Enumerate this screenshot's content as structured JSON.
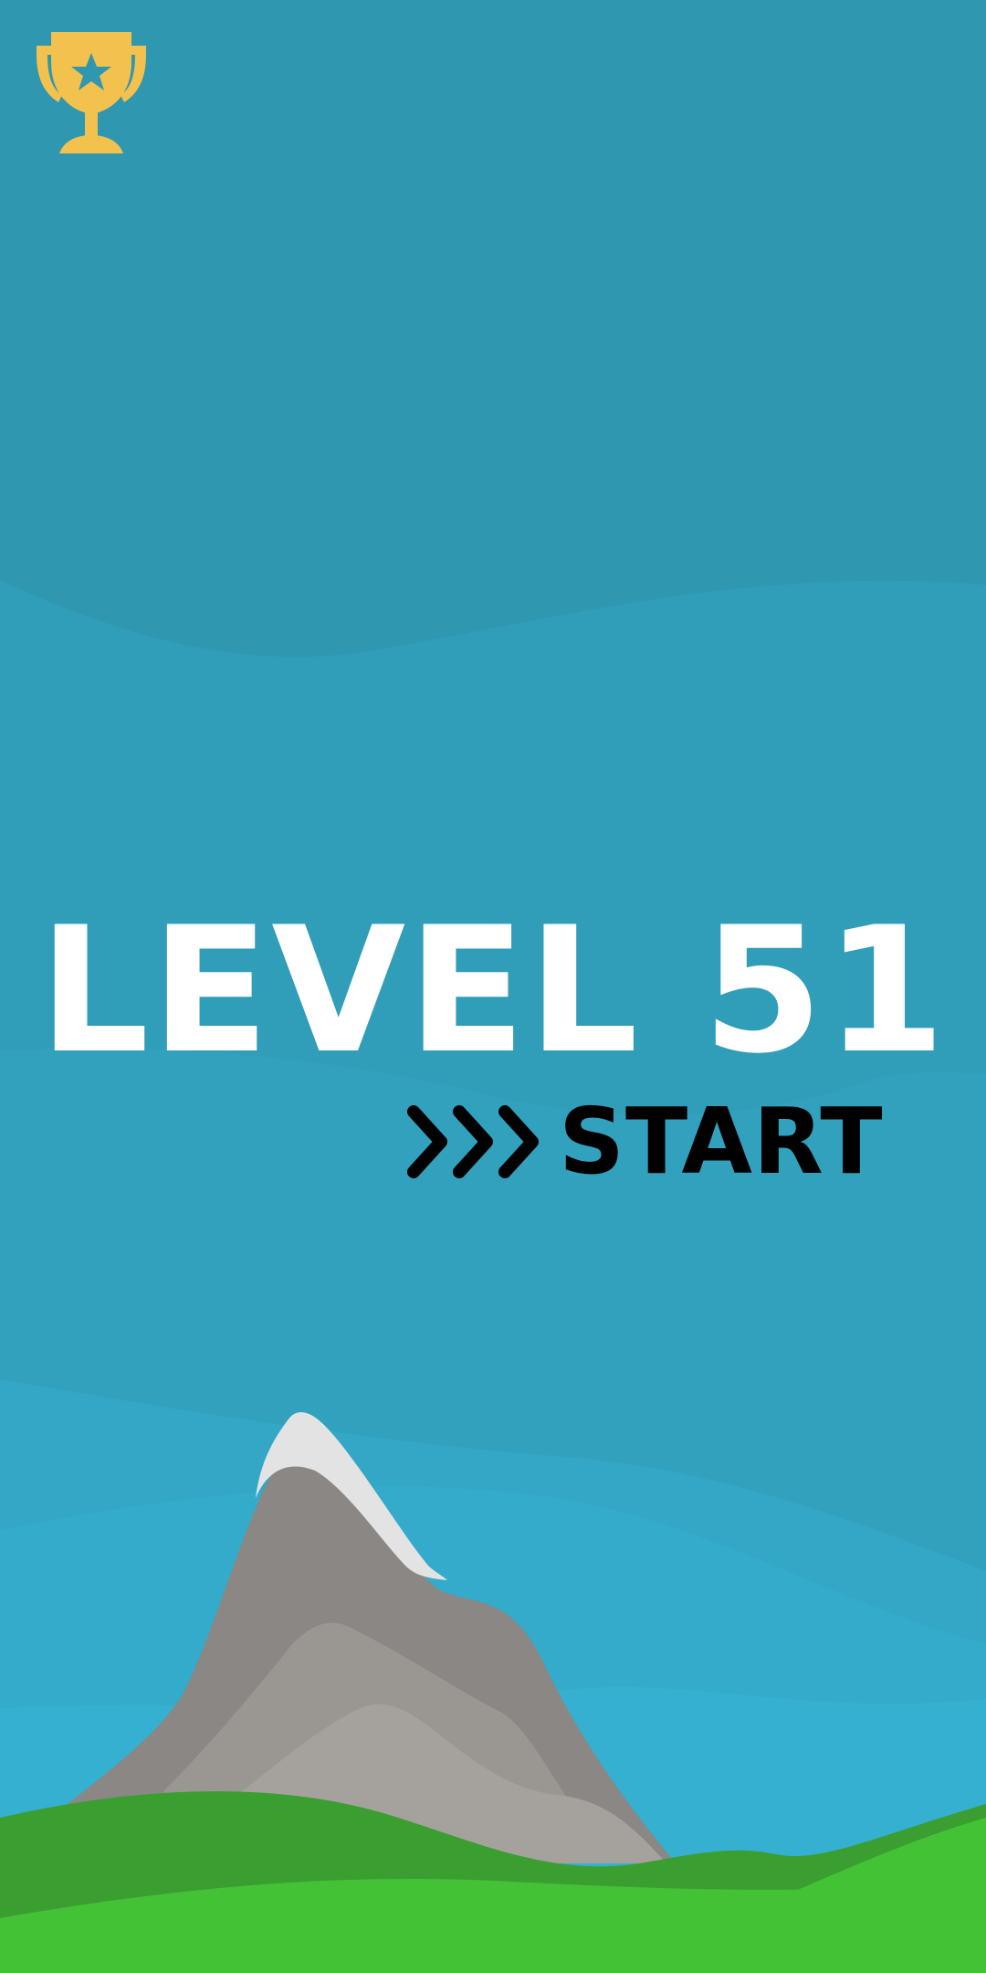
{
  "screen": {
    "level_title": "LEVEL 51",
    "start_label": "START"
  },
  "icons": {
    "trophy": "trophy-icon",
    "start_arrows": "triple-chevron-right-icon"
  },
  "colors": {
    "sky_top": "#2f97b0",
    "sky_band": "#309db9",
    "sky_low": "#34aecf",
    "trophy": "#f2c14e",
    "title_text": "#ffffff",
    "start_text": "#000000",
    "mountain_dark": "#8a8784",
    "mountain_mid": "#9a9692",
    "mountain_light": "#a5a29d",
    "snow": "#e3e3e3",
    "grass_dark": "#3a9f30",
    "grass_light": "#44c236"
  }
}
